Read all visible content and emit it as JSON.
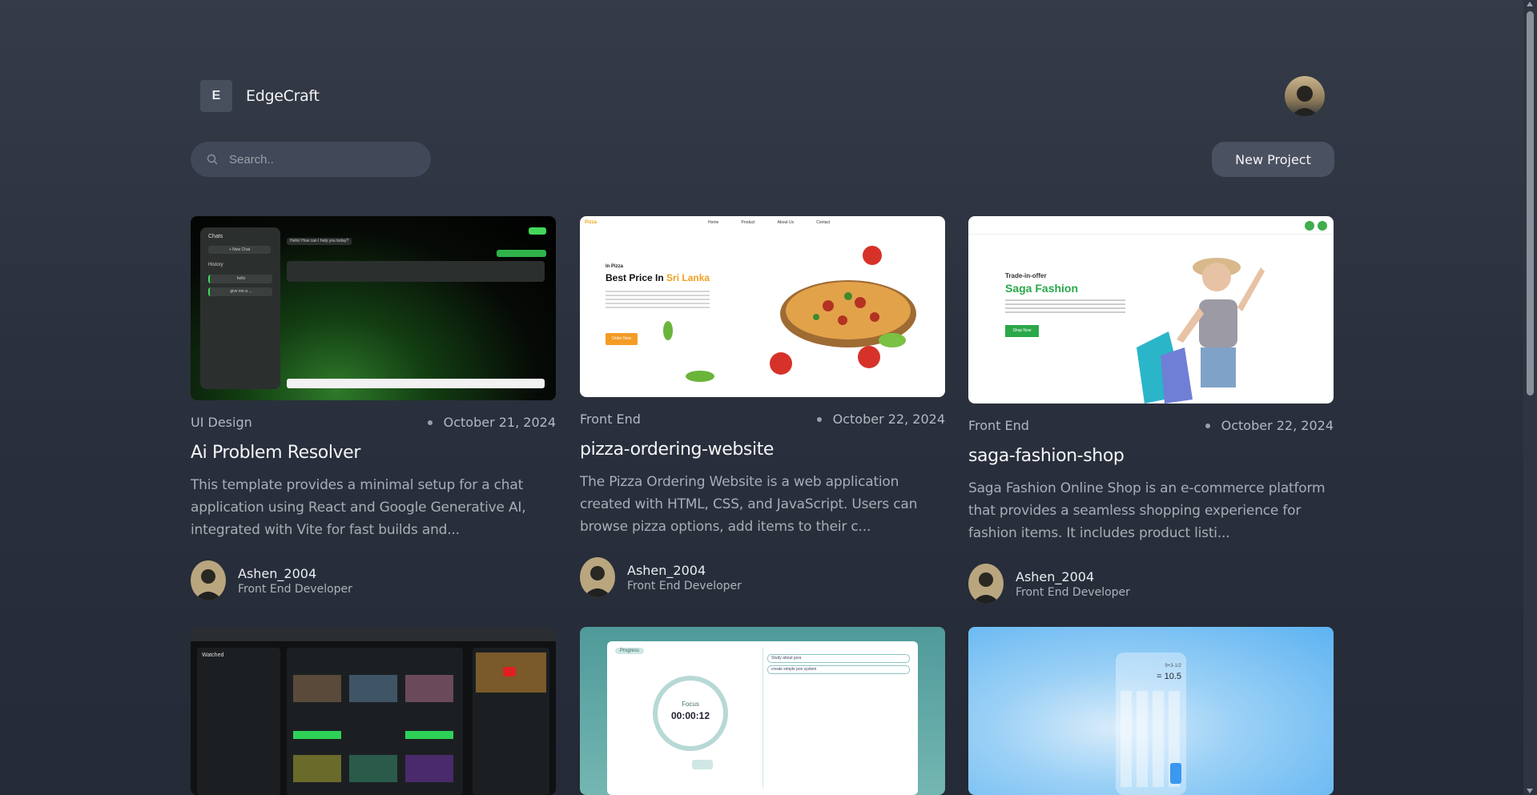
{
  "header": {
    "logo_letter": "E",
    "brand": "EdgeCraft"
  },
  "search": {
    "placeholder": "Search.."
  },
  "new_project_label": "New Project",
  "projects": [
    {
      "category": "UI Design",
      "date": "October 21, 2024",
      "title": "Ai Problem Resolver",
      "description": "This template provides a minimal setup for a chat application using React and Google Generative AI, integrated with Vite for fast builds and...",
      "author": "Ashen_2004",
      "role": "Front End Developer"
    },
    {
      "category": "Front End",
      "date": "October 22, 2024",
      "title": "pizza-ordering-website",
      "description": "The Pizza Ordering Website is a web application created with HTML, CSS, and JavaScript. Users can browse pizza options, add items to their c...",
      "author": "Ashen_2004",
      "role": "Front End Developer"
    },
    {
      "category": "Front End",
      "date": "October 22, 2024",
      "title": "saga-fashion-shop",
      "description": "Saga Fashion Online Shop is an e-commerce platform that provides a seamless shopping experience for fashion items. It includes product listi...",
      "author": "Ashen_2004",
      "role": "Front End Developer"
    }
  ],
  "thumb_text": {
    "chat": {
      "sidebar_title": "Chats",
      "new_chat": "+ New Chat",
      "history": "History",
      "hist1": "hello",
      "hist2": "give me a ...",
      "greeting": "Hello! How can I help you today?"
    },
    "pizza": {
      "brand": "Pizza",
      "nav": [
        "Home",
        "Product",
        "About Us",
        "Contact"
      ],
      "kicker": "In Pizza",
      "headline": "Best Price In",
      "highlight": "Sri Lanka",
      "cta": "Order Now"
    },
    "fashion": {
      "kicker": "Trade-in-offer",
      "headline": "Saga Fashion",
      "cta": "Shop Now"
    },
    "watch": {
      "title": "Watched"
    },
    "focus": {
      "tag": "Progress",
      "label": "Focus",
      "time": "00:00:12",
      "task1": "Study about java",
      "task2": "create simple pos system"
    },
    "calc": {
      "expr": "9+3-1/2",
      "result": "= 10.5"
    }
  }
}
